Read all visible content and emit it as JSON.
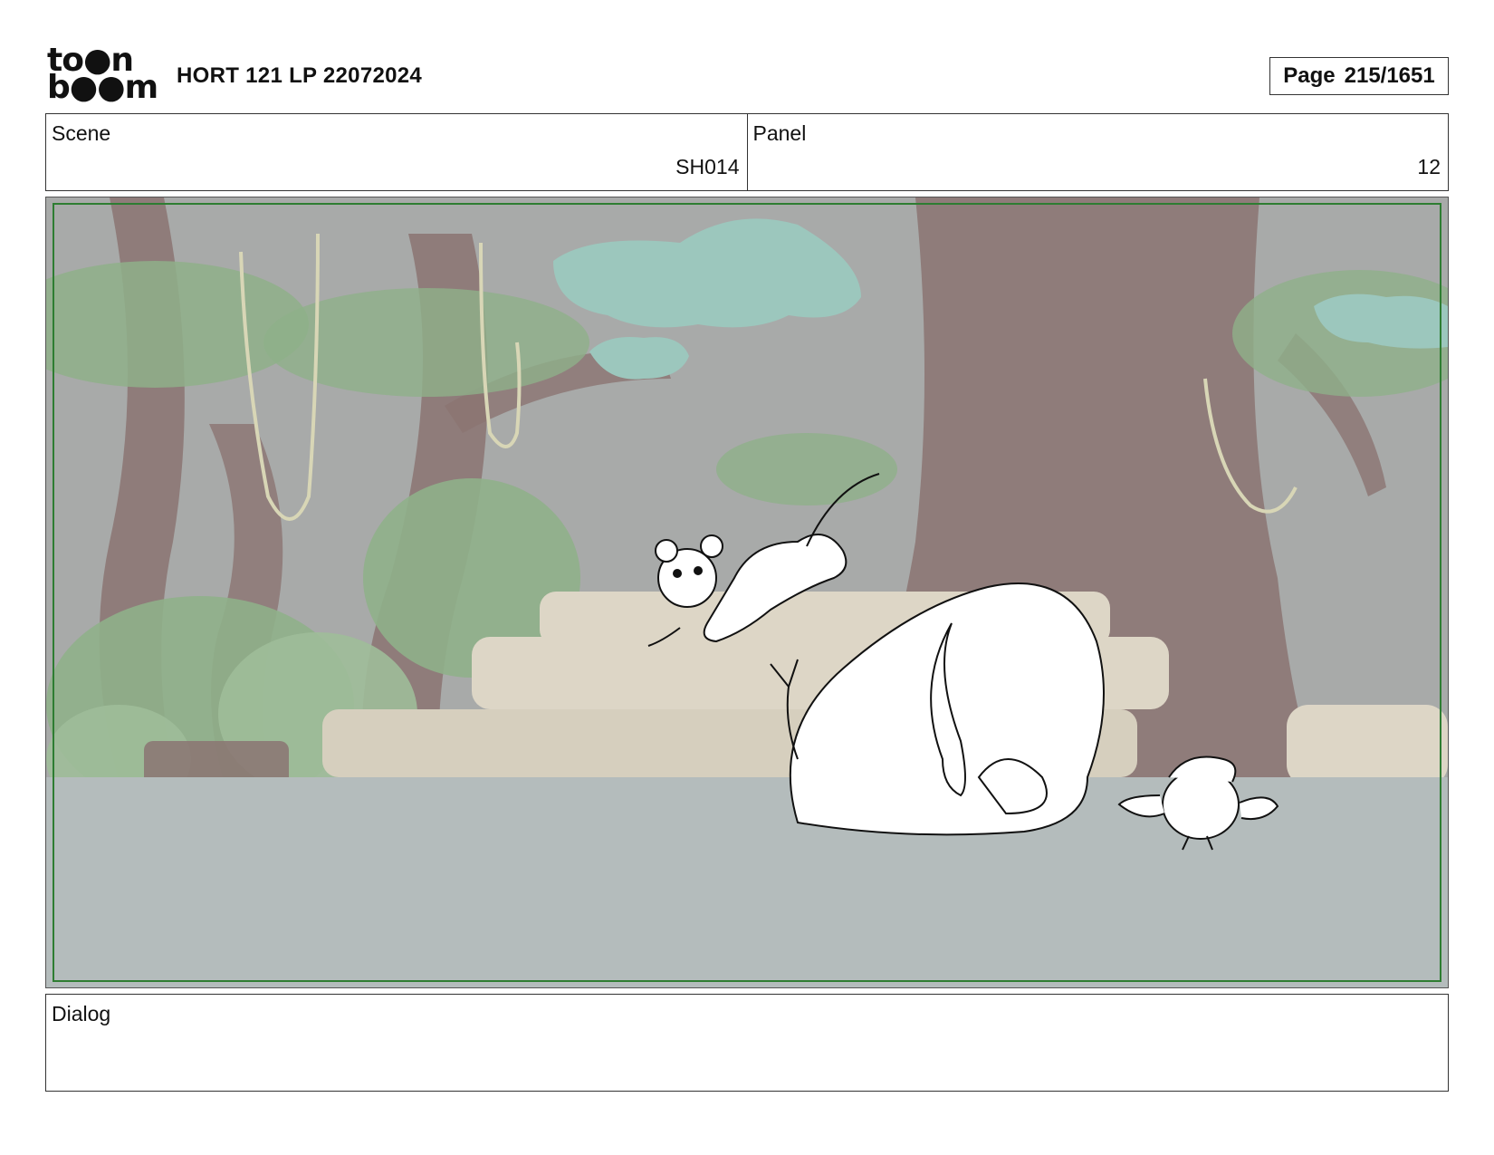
{
  "header": {
    "logo_top": "to●n",
    "logo_bottom": "b●●m",
    "title": "HORT 121 LP 22072024",
    "page_label": "Page",
    "page_value": "215/1651"
  },
  "scene": {
    "label": "Scene",
    "value": "SH014"
  },
  "panel": {
    "label": "Panel",
    "value": "12"
  },
  "dialog": {
    "label": "Dialog",
    "text": ""
  },
  "artwork": {
    "description_icons": [
      "jungle-background",
      "mouse-character-sketch",
      "elephant-character-sketch",
      "bird-character-sketch"
    ],
    "colors": {
      "safe_frame": "#2e7d32",
      "sky": "#a8aaa9",
      "ground": "#b4bcbc",
      "trunk": "#8b7472",
      "foliage": "#8fb08a",
      "canopy_teal": "#9cc7bd",
      "steps": "#ddd6c6"
    }
  }
}
